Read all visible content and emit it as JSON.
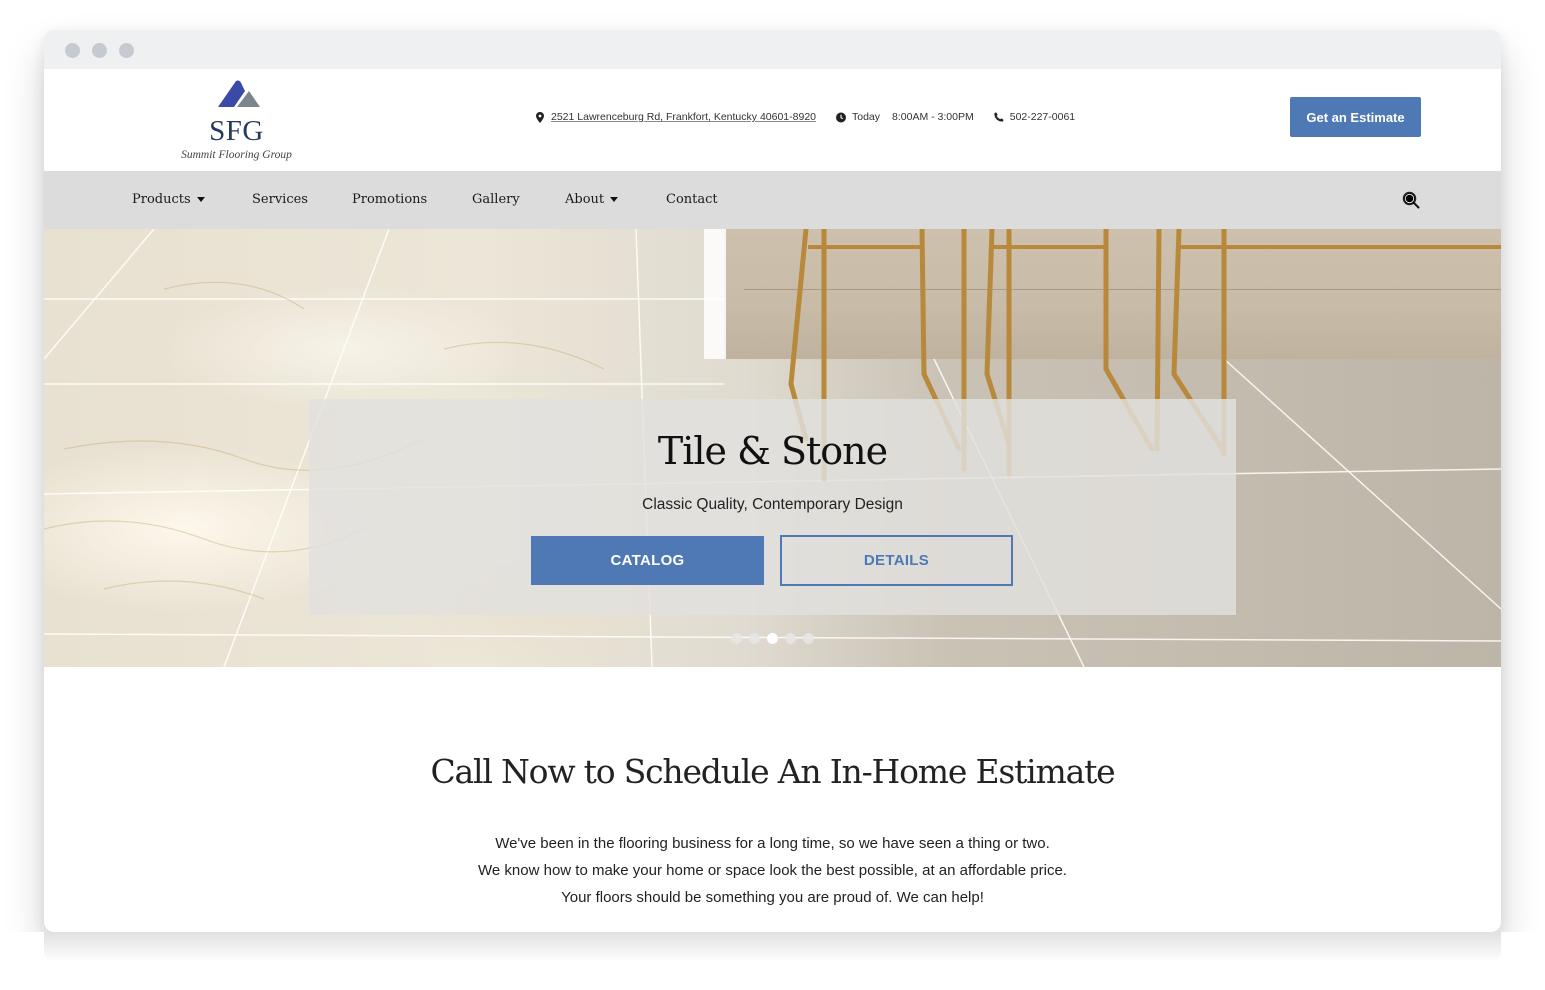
{
  "window": {
    "controls": [
      "close",
      "minimize",
      "maximize"
    ]
  },
  "header": {
    "logo": {
      "initials": "SFG",
      "name": "Summit Flooring Group",
      "colors": {
        "primary_triangle": "#3a4aa6",
        "secondary_triangle": "#7a858e",
        "text": "#243a5e"
      }
    },
    "address": "2521 Lawrenceburg Rd, Frankfort, Kentucky 40601-8920",
    "hours_label": "Today",
    "hours_value": "8:00AM - 3:00PM",
    "phone": "502-227-0061",
    "icons": {
      "address": "map-pin-icon",
      "hours": "clock-icon",
      "phone": "phone-icon"
    },
    "cta_label": "Get an Estimate"
  },
  "nav": {
    "items": [
      {
        "label": "Products",
        "dropdown": true
      },
      {
        "label": "Services",
        "dropdown": false
      },
      {
        "label": "Promotions",
        "dropdown": false
      },
      {
        "label": "Gallery",
        "dropdown": false
      },
      {
        "label": "About",
        "dropdown": true
      },
      {
        "label": "Contact",
        "dropdown": false
      }
    ],
    "search_icon": "search-icon"
  },
  "hero": {
    "title": "Tile & Stone",
    "subtitle": "Classic Quality, Contemporary Design",
    "primary_button": "CATALOG",
    "secondary_button": "DETAILS",
    "slides_total": 5,
    "active_slide": 3
  },
  "content": {
    "title": "Call Now to Schedule An In-Home Estimate",
    "lines": [
      "We've been in the flooring business for a long time, so we have seen a thing or two.",
      "We know how to make your home or space look the best possible, at an affordable price.",
      "Your floors should be something you are proud of. We can help!"
    ]
  },
  "colors": {
    "accent": "#4f79b5",
    "nav_bg": "#dcdcdc",
    "titlebar_bg": "#eff0f2"
  }
}
